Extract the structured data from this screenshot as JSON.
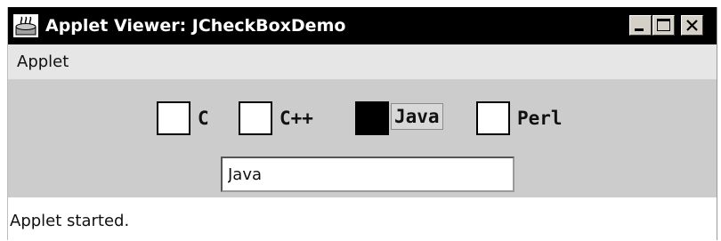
{
  "window": {
    "title": "Applet Viewer: JCheckBoxDemo",
    "icon": "applet-viewer-icon",
    "controls": {
      "minimize_icon": "minimize-icon",
      "maximize_icon": "maximize-icon",
      "close_icon": "close-icon"
    }
  },
  "menubar": {
    "items": [
      {
        "label": "Applet"
      }
    ]
  },
  "checkboxes": [
    {
      "label": "C",
      "checked": false,
      "focused": false
    },
    {
      "label": "C++",
      "checked": false,
      "focused": false
    },
    {
      "label": "Java",
      "checked": true,
      "focused": true
    },
    {
      "label": "Perl",
      "checked": false,
      "focused": false
    }
  ],
  "text_field": {
    "value": "Java"
  },
  "status": {
    "text": "Applet started."
  },
  "colors": {
    "titlebar": "#000000",
    "title_text": "#ffffff",
    "menubar": "#e6e6e6",
    "content": "#cccccc",
    "statusbar": "#ffffff",
    "checked_box": "#000000"
  }
}
